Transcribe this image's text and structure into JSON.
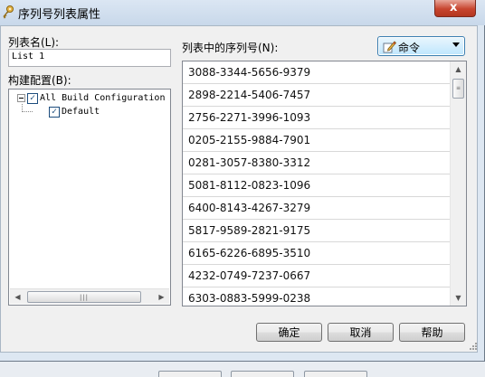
{
  "window": {
    "title": "序列号列表属性",
    "close_glyph": "x"
  },
  "list_name": {
    "label": "列表名(L):",
    "value": "List 1"
  },
  "build_config": {
    "label": "构建配置(B):",
    "tree": [
      {
        "label": "All Build Configuration",
        "checked": true,
        "expanded": true
      },
      {
        "label": "Default",
        "checked": true
      }
    ]
  },
  "serial_list": {
    "label": "列表中的序列号(N):",
    "items": [
      "3088-3344-5656-9379",
      "2898-2214-5406-7457",
      "2756-2271-3996-1093",
      "0205-2155-9884-7901",
      "0281-3057-8380-3312",
      "5081-8112-0823-1096",
      "6400-8143-4267-3279",
      "5817-9589-2821-9175",
      "6165-6226-6895-3510",
      "4232-0749-7237-0667",
      "6303-0883-5999-0238"
    ]
  },
  "command_button": {
    "label": "命令",
    "icon": "pencil-icon"
  },
  "buttons": {
    "ok": "确定",
    "cancel": "取消",
    "help": "帮助"
  },
  "colors": {
    "accent": "#3c7fb1",
    "close": "#c7452f"
  }
}
